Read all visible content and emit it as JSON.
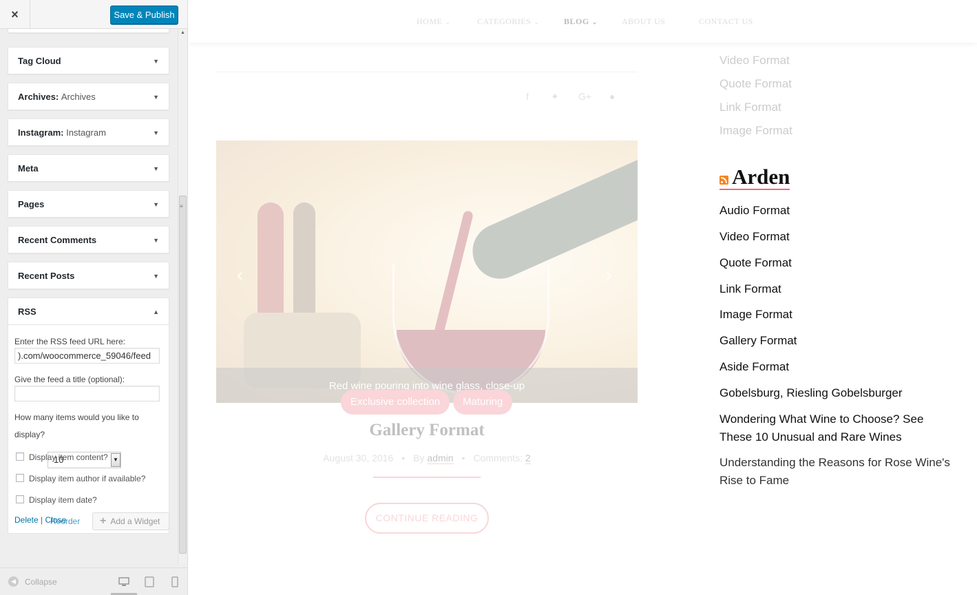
{
  "customizer": {
    "close_icon": "×",
    "publish_label": "Save & Publish",
    "widgets": [
      {
        "title": "Tag Cloud",
        "subtitle": ""
      },
      {
        "title": "Archives:",
        "subtitle": "Archives"
      },
      {
        "title": "Instagram:",
        "subtitle": "Instagram"
      },
      {
        "title": "Meta",
        "subtitle": ""
      },
      {
        "title": "Pages",
        "subtitle": ""
      },
      {
        "title": "Recent Comments",
        "subtitle": ""
      },
      {
        "title": "Recent Posts",
        "subtitle": ""
      },
      {
        "title": "RSS",
        "subtitle": ""
      }
    ],
    "rss_form": {
      "url_label": "Enter the RSS feed URL here:",
      "url_value": ").com/woocommerce_59046/feed",
      "title_label": "Give the feed a title (optional):",
      "title_value": "",
      "items_label_line1": "How many items would you like to",
      "items_label_line2": "display?",
      "items_value": "10",
      "chk_content": "Display item content?",
      "chk_author": "Display item author if available?",
      "chk_date": "Display item date?",
      "delete_label": "Delete",
      "separator": "|",
      "close_label": "Close"
    },
    "reorder_label": "Reorder",
    "add_widget_label": "Add a Widget",
    "collapse_label": "Collapse"
  },
  "preview": {
    "nav": [
      {
        "label": "HOME",
        "has_caret": true
      },
      {
        "label": "CATEGORIES",
        "has_caret": true
      },
      {
        "label": "BLOG",
        "has_caret": true,
        "active": true
      },
      {
        "label": "ABOUT US",
        "has_caret": false
      },
      {
        "label": "CONTACT US",
        "has_caret": false
      }
    ],
    "caret": "⌄",
    "post": {
      "slide_caption": "Red wine pouring into wine glass, close-up",
      "tags": [
        "Exclusive collection",
        "Maturing"
      ],
      "title": "Gallery Format",
      "date": "August 30, 2016",
      "by_label": "By",
      "author": "admin",
      "comments_label": "Comments:",
      "comments_count": "2",
      "continue_label": "CONTINUE READING"
    },
    "faded_links": [
      "Video Format",
      "Quote Format",
      "Link Format",
      "Image Format"
    ],
    "rss_widget": {
      "title": "Arden",
      "links": [
        "Audio Format",
        "Video Format",
        "Quote Format",
        "Link Format",
        "Image Format",
        "Gallery Format",
        "Aside Format",
        "Gobelsburg, Riesling Gobelsburger",
        "Wondering What Wine to Choose? See These 10 Unusual and Rare Wines",
        "Understanding the Reasons for Rose Wine's Rise to Fame"
      ]
    }
  },
  "colors": {
    "publish": "#0085ba",
    "link": "#0073aa",
    "accent": "#ee6b7a",
    "rss": "#f78422"
  }
}
